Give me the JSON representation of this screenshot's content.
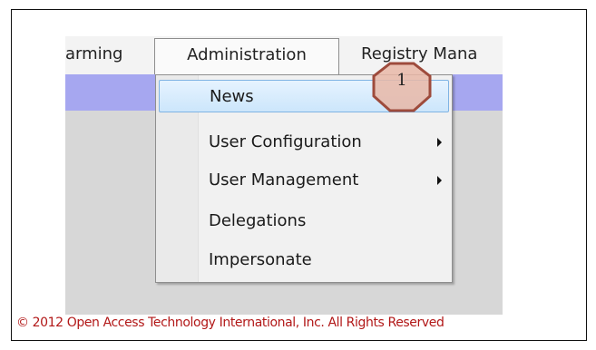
{
  "menubar": {
    "items": [
      {
        "label": "arming"
      },
      {
        "label": "Administration"
      },
      {
        "label": "Registry Mana"
      }
    ]
  },
  "dropdown": {
    "items": [
      {
        "label": "News",
        "has_submenu": false,
        "highlighted": true
      },
      {
        "label": "User Configuration",
        "has_submenu": true
      },
      {
        "label": "User Management",
        "has_submenu": true
      },
      {
        "label": "Delegations",
        "has_submenu": false
      },
      {
        "label": "Impersonate",
        "has_submenu": false
      }
    ]
  },
  "callout": {
    "label": "1",
    "fill": "#e8b7a7",
    "stroke": "#9e4b3c"
  },
  "footer": {
    "text": "© 2012 Open Access Technology International, Inc. All Rights Reserved"
  },
  "colors": {
    "band": "#a6a7f0",
    "content": "#d7d7d7",
    "footer_text": "#b21818",
    "highlight": "#cce6fb"
  }
}
